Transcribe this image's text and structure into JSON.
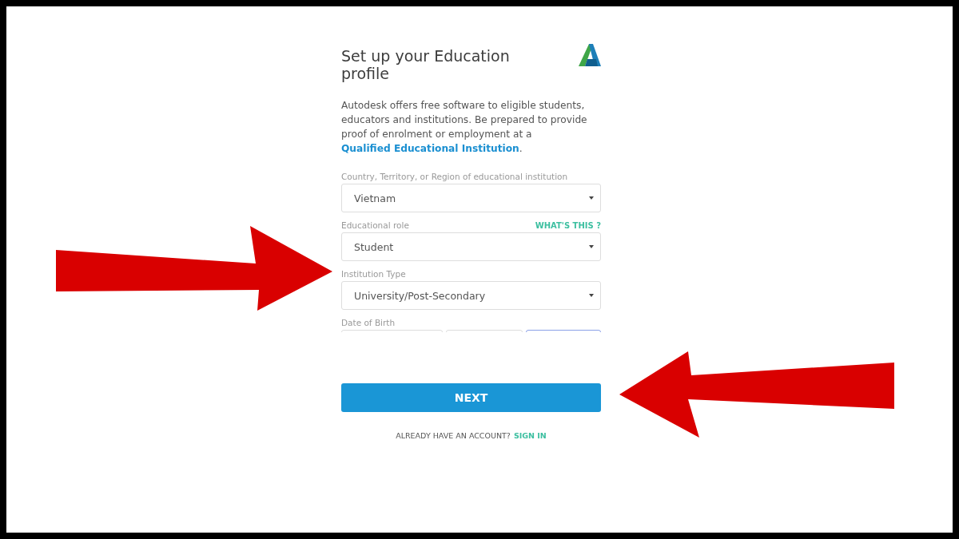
{
  "title": "Set up your Education profile",
  "intro": {
    "text": "Autodesk offers free software to eligible students, educators and institutions. Be prepared to provide proof of enrolment or employment at a ",
    "link": "Qualified Educational Institution",
    "after": "."
  },
  "fields": [
    {
      "label": "Country, Territory, or Region of educational institution",
      "value": "Vietnam"
    },
    {
      "label": "Educational role",
      "help": "WHAT'S THIS ?",
      "value": "Student"
    },
    {
      "label": "Institution Type",
      "value": "University/Post-Secondary"
    }
  ],
  "date_of_birth": {
    "label": "Date of Birth",
    "parts": [
      {
        "focused": false
      },
      {
        "focused": false
      },
      {
        "focused": true
      }
    ]
  },
  "next_button": "NEXT",
  "account": {
    "text": "ALREADY HAVE AN ACCOUNT?",
    "link": "SIGN IN"
  },
  "annotations": [
    {
      "kind": "right-arrow"
    },
    {
      "kind": "left-arrow"
    }
  ]
}
